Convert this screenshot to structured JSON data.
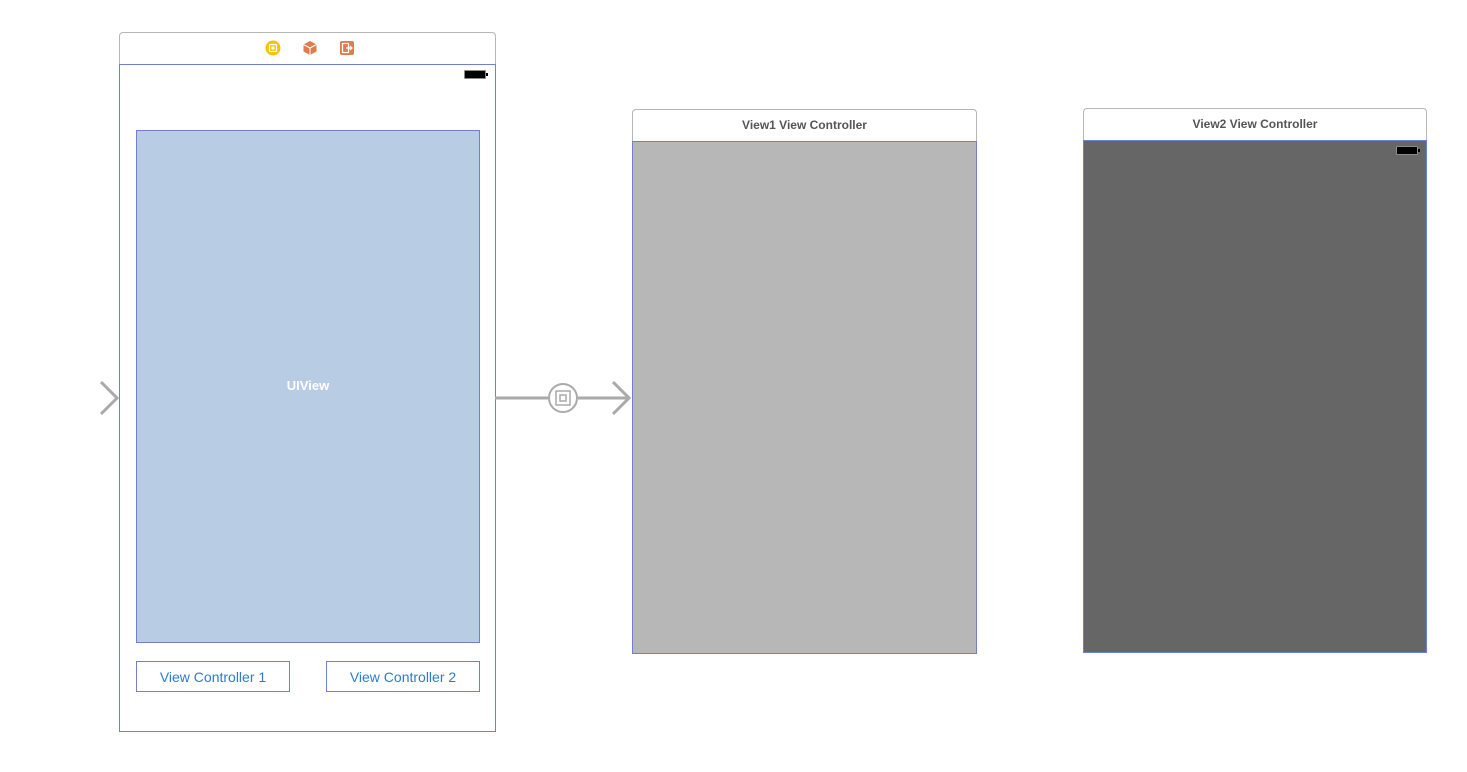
{
  "main_scene": {
    "dock_icons": [
      "view-controller-icon",
      "first-responder-icon",
      "exit-icon"
    ],
    "content_view_label": "UIView",
    "buttons": [
      {
        "label": "View Controller 1"
      },
      {
        "label": "View Controller 2"
      }
    ]
  },
  "view1_scene": {
    "title": "View1 View Controller",
    "background": "#b7b7b7"
  },
  "view2_scene": {
    "title": "View2 View Controller",
    "background": "#666666"
  },
  "colors": {
    "content_view": "#b8cce4",
    "selection_border": "#6f7fd1",
    "button_text": "#2d7bd1",
    "segue_arrow": "#aaaaaa",
    "dock_vc_icon": "#f5c400",
    "dock_responder_icon": "#e07b4a"
  }
}
